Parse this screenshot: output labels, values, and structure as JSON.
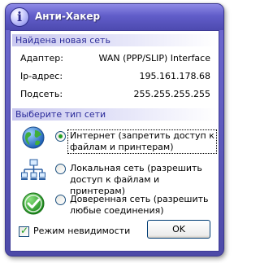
{
  "window": {
    "title": "Анти-Хакер"
  },
  "found_network": {
    "header": "Найдена новая сеть",
    "rows": [
      {
        "label": "Адаптер:",
        "value": "WAN (PPP/SLIP) Interface"
      },
      {
        "label": "Ip-адрес:",
        "value": "195.161.178.68"
      },
      {
        "label": "Подсеть:",
        "value": "255.255.255.255"
      }
    ]
  },
  "network_type": {
    "header": "Выберите тип сети",
    "options": [
      {
        "line1": "Интернет (запретить доступ к",
        "line2": "файлам и принтерам)",
        "selected": true,
        "icon": "globe-icon"
      },
      {
        "line1": "Локальная сеть (разрешить",
        "line2": "доступ к файлам и принтерам)",
        "selected": false,
        "icon": "local-network-icon"
      },
      {
        "line1": "Доверенная сеть (разрешить",
        "line2": "любые соединения)",
        "selected": false,
        "icon": "trusted-check-icon"
      }
    ]
  },
  "stealth_mode": {
    "label": "Режим невидимости",
    "checked": true
  },
  "buttons": {
    "ok_label": "OK"
  },
  "colors": {
    "title_bar": "#615dc9",
    "group_header_text": "#2b2b9a",
    "radio_selected": "#21a121"
  }
}
